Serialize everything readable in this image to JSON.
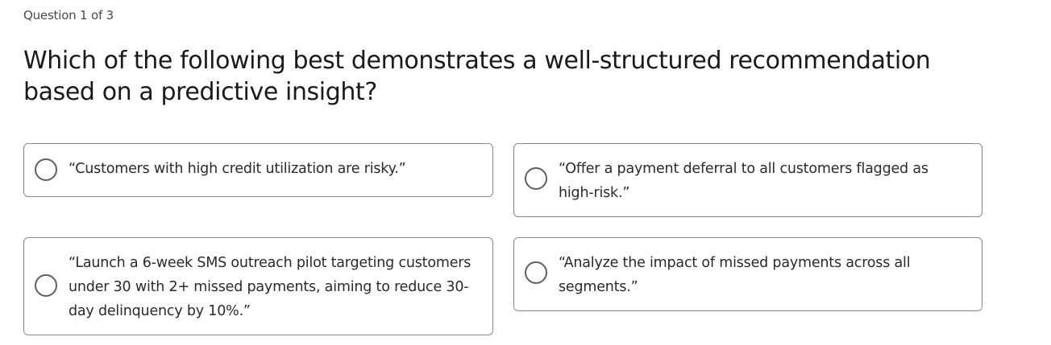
{
  "quiz": {
    "counter": "Question 1 of 3",
    "question": "Which of the following best demonstrates a well-structured recommendation based on a predictive insight?",
    "options": [
      {
        "text": "“Customers with high credit utilization are risky.”",
        "selected": false
      },
      {
        "text": "“Offer a payment deferral to all customers flagged as high-risk.”",
        "selected": false
      },
      {
        "text": "“Launch a 6-week SMS outreach pilot targeting customers under 30 with 2+ missed payments, aiming to reduce 30-day delinquency by 10%.”",
        "selected": false
      },
      {
        "text": "“Analyze the impact of missed payments across all segments.”",
        "selected": false
      }
    ]
  }
}
